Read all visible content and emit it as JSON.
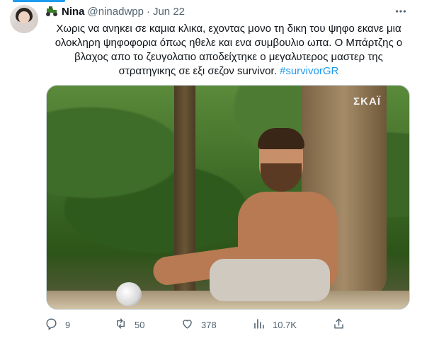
{
  "tweet": {
    "author_name": "Nina",
    "author_handle": "@ninadwpp",
    "separator": "·",
    "date": "Jun 22",
    "text": "Χωρις να ανηκει σε καμια κλικα, εχοντας μονο τη δικη του ψηφο εκανε μια ολοκληρη ψηφοφορια όπως ηθελε και ενα συμβουλιο ωπα. Ο Μπάρτζης ο βλαχος απο το ζευγολατιο αποδείχτηκε ο μεγαλυτερος μαστερ της στρατηγικης σε εξι σεζον survivor.",
    "hashtag": "#survivorGR",
    "media_logo": "ΣΚΑΪ",
    "accent_color": "#1d9bf0"
  },
  "icons": {
    "badge": "tractor-icon",
    "more": "more-icon",
    "reply": "reply-icon",
    "retweet": "retweet-icon",
    "like": "heart-icon",
    "views": "views-icon",
    "share": "share-icon"
  },
  "actions": {
    "replies": "9",
    "retweets": "50",
    "likes": "378",
    "views": "10.7K"
  }
}
